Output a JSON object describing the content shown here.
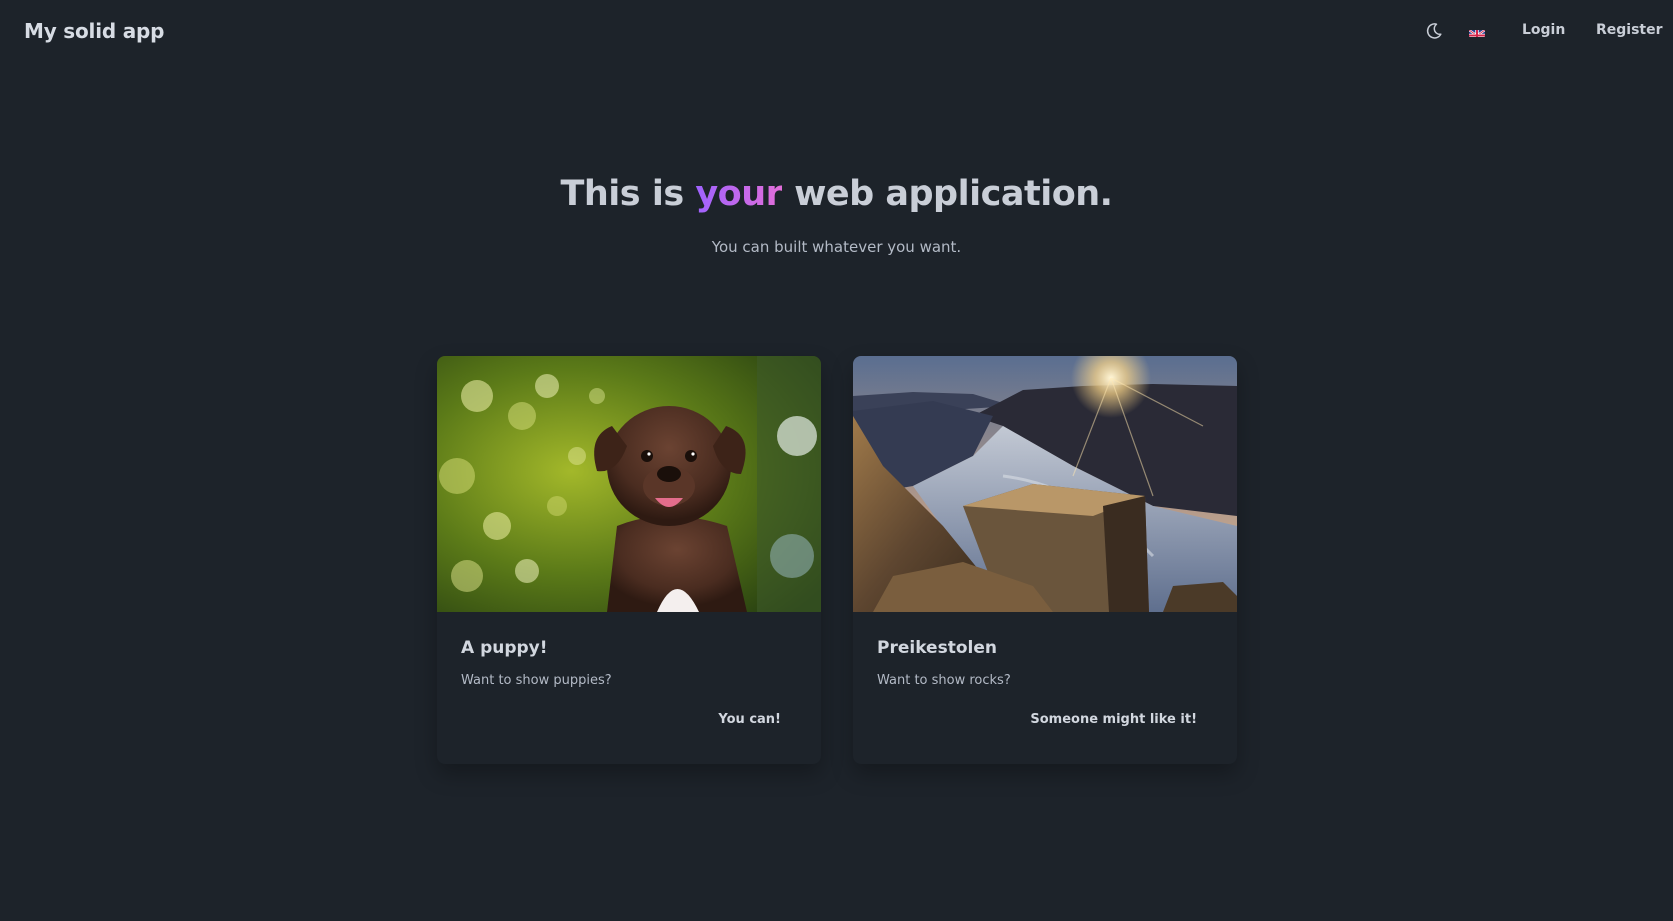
{
  "navbar": {
    "brand": "My solid app",
    "theme_icon": "moon-icon",
    "language_icon": "uk-flag-icon",
    "login_label": "Login",
    "register_label": "Register"
  },
  "hero": {
    "title_before": "This is ",
    "title_accent": "your",
    "title_after": " web application.",
    "subtitle": "You can built whatever you want.",
    "accent_colors": [
      "#9f62ff",
      "#e26ed9"
    ]
  },
  "cards": [
    {
      "image": "puppy-photo",
      "title": "A puppy!",
      "text": "Want to show puppies?",
      "action_label": "You can!"
    },
    {
      "image": "fjord-cliff-photo",
      "title": "Preikestolen",
      "text": "Want to show rocks?",
      "action_label": "Someone might like it!"
    }
  ],
  "colors": {
    "background": "#1d232a",
    "text": "#a6adbb"
  }
}
